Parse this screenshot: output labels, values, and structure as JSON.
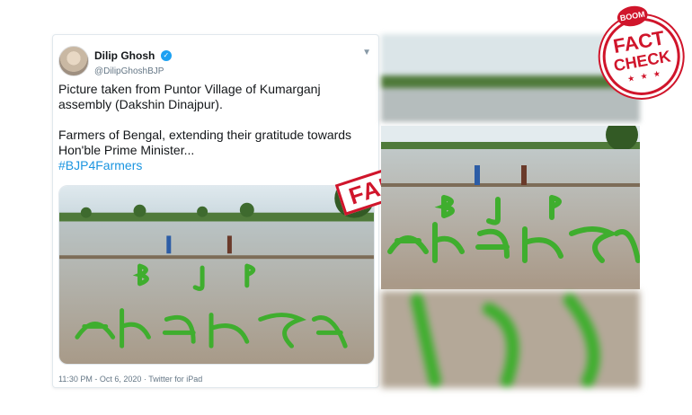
{
  "tweet": {
    "author_name": "Dilip Ghosh",
    "handle": "@DilipGhoshBJP",
    "text_line1": "Picture taken from Puntor Village of Kumarganj",
    "text_line2": "assembly (Dakshin Dinajpur).",
    "text_line3": "Farmers of Bengal, extending their gratitude towards",
    "text_line4": "Hon'ble Prime Minister...",
    "hashtag": "#BJP4Farmers",
    "timestamp": "11:30 PM - Oct 6, 2020 · Twitter for iPad"
  },
  "stamp": {
    "label": "FAKE"
  },
  "badge": {
    "top": "BOOM",
    "line1": "FACT",
    "line2": "CHECK",
    "stars": "★ ★ ★"
  },
  "colors": {
    "brand_red": "#d0152b",
    "twitter_blue": "#1b95e0",
    "paddy_green": "#3fae2e"
  },
  "icons": {
    "verified": "verified-badge-icon",
    "chevron": "chevron-down-icon"
  }
}
